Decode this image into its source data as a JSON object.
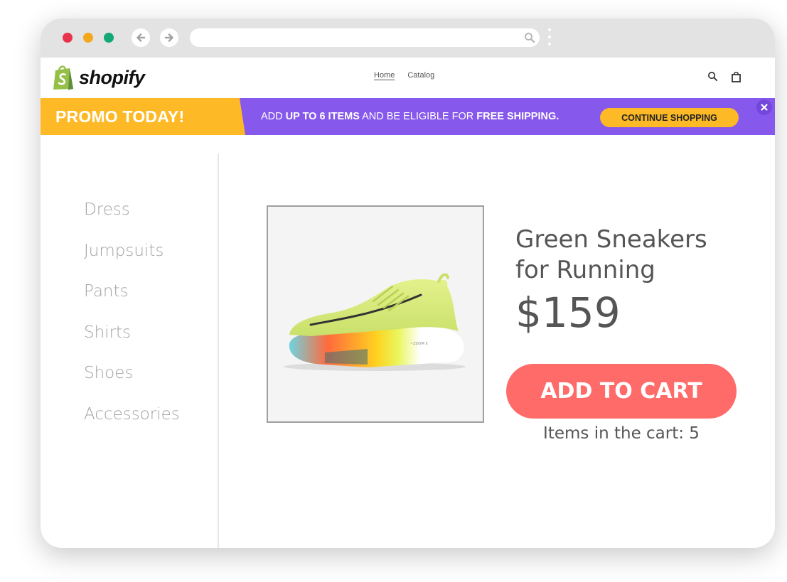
{
  "browser": {
    "url": ""
  },
  "header": {
    "logo_text": "shopify",
    "nav": [
      {
        "label": "Home"
      },
      {
        "label": "Catalog"
      }
    ]
  },
  "promo": {
    "title": "PROMO TODAY!",
    "message_parts": [
      "ADD ",
      "UP TO 6 ITEMS",
      " AND BE ELIGIBLE FOR ",
      "FREE SHIPPING."
    ],
    "button_label": "CONTINUE SHOPPING"
  },
  "sidebar": {
    "items": [
      {
        "label": "Dress"
      },
      {
        "label": "Jumpsuits"
      },
      {
        "label": "Pants"
      },
      {
        "label": "Shirts"
      },
      {
        "label": "Shoes"
      },
      {
        "label": "Accessories"
      }
    ]
  },
  "product": {
    "title": "Green Sneakers for Running",
    "price": "$159",
    "add_to_cart_label": "ADD TO CART",
    "cart_count_text": "Items in the cart: 5"
  },
  "colors": {
    "promo_purple": "#8758ec",
    "promo_yellow": "#fdb926",
    "cart_button": "#ff6b69",
    "shopify_green": "#95bf47"
  }
}
